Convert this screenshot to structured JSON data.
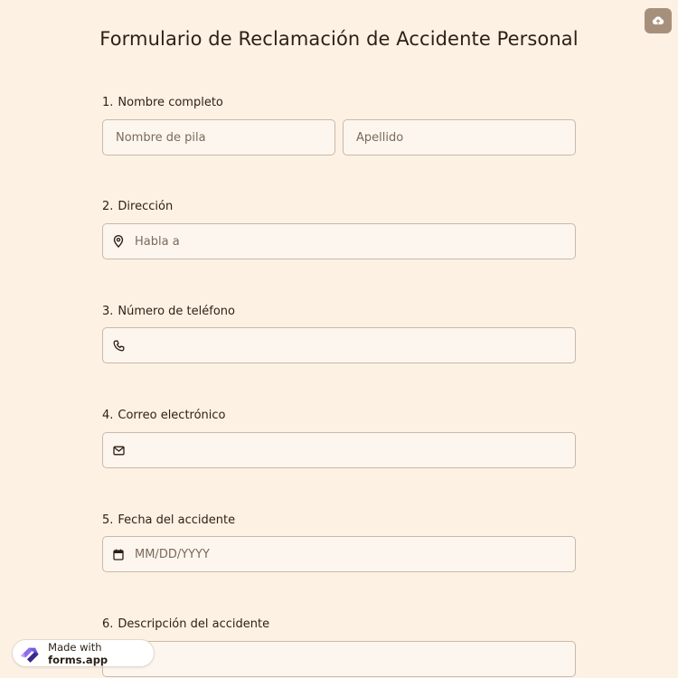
{
  "form": {
    "title": "Formulario de Reclamación de Accidente Personal"
  },
  "questions": [
    {
      "number": "1.",
      "label": "Nombre completo",
      "first_placeholder": "Nombre de pila",
      "last_placeholder": "Apellido"
    },
    {
      "number": "2.",
      "label": "Dirección",
      "placeholder": "Habla a"
    },
    {
      "number": "3.",
      "label": "Número de teléfono",
      "placeholder": ""
    },
    {
      "number": "4.",
      "label": "Correo electrónico",
      "placeholder": ""
    },
    {
      "number": "5.",
      "label": "Fecha del accidente",
      "placeholder": "MM/DD/YYYY"
    },
    {
      "number": "6.",
      "label": "Descripción del accidente",
      "placeholder": ""
    }
  ],
  "badge": {
    "prefix": "Made with ",
    "brand": "forms.app"
  },
  "icons": {
    "save": "cloud-upload-icon",
    "address": "map-pin-icon",
    "phone": "phone-icon",
    "email": "envelope-icon",
    "date": "calendar-icon",
    "logo": "forms-app-logo-icon"
  },
  "colors": {
    "background": "#fdf1e4",
    "field_background": "#fdf6ee",
    "field_border": "#c9b9a8",
    "save_button": "#a7907b"
  }
}
